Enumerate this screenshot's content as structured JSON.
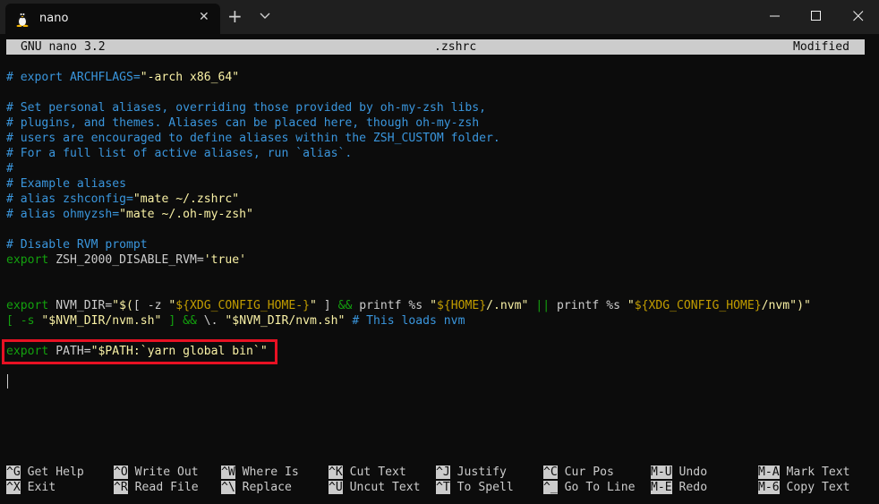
{
  "tab": {
    "title": "nano",
    "close_glyph": "✕",
    "icon": "tux-icon"
  },
  "titlebar": {
    "new_tab_glyph": "+"
  },
  "header": {
    "left": "GNU nano 3.2",
    "center": ".zshrc",
    "right": "Modified"
  },
  "lines": [
    [
      {
        "t": "# export ARCHFLAGS=",
        "c": "comment"
      },
      {
        "t": "\"-arch x86_64\"",
        "c": "str"
      }
    ],
    [],
    [
      {
        "t": "# Set personal aliases, overriding those provided by oh-my-zsh libs,",
        "c": "comment"
      }
    ],
    [
      {
        "t": "# plugins, and themes. Aliases can be placed here, though oh-my-zsh",
        "c": "comment"
      }
    ],
    [
      {
        "t": "# users are encouraged to define aliases within the ZSH_CUSTOM folder.",
        "c": "comment"
      }
    ],
    [
      {
        "t": "# For a full list of active aliases, run `alias`.",
        "c": "comment"
      }
    ],
    [
      {
        "t": "#",
        "c": "comment"
      }
    ],
    [
      {
        "t": "# Example aliases",
        "c": "comment"
      }
    ],
    [
      {
        "t": "# alias zshconfig=",
        "c": "comment"
      },
      {
        "t": "\"mate ~/.zshrc\"",
        "c": "str"
      }
    ],
    [
      {
        "t": "# alias ohmyzsh=",
        "c": "comment"
      },
      {
        "t": "\"mate ~/.oh-my-zsh\"",
        "c": "str"
      }
    ],
    [],
    [
      {
        "t": "# Disable RVM prompt",
        "c": "comment"
      }
    ],
    [
      {
        "t": "export",
        "c": "kw"
      },
      {
        "t": " ZSH_2000_DISABLE_RVM=",
        "c": "plain"
      },
      {
        "t": "'true'",
        "c": "str"
      }
    ],
    [],
    [],
    [
      {
        "t": "export",
        "c": "kw"
      },
      {
        "t": " NVM_DIR=",
        "c": "plain"
      },
      {
        "t": "\"$(",
        "c": "str"
      },
      {
        "t": "[ -z ",
        "c": "plain"
      },
      {
        "t": "\"",
        "c": "str"
      },
      {
        "t": "${XDG_CONFIG_HOME-}",
        "c": "var"
      },
      {
        "t": "\"",
        "c": "str"
      },
      {
        "t": " ] ",
        "c": "plain"
      },
      {
        "t": "&&",
        "c": "kw"
      },
      {
        "t": " printf %s ",
        "c": "plain"
      },
      {
        "t": "\"",
        "c": "str"
      },
      {
        "t": "${HOME}",
        "c": "var"
      },
      {
        "t": "/.nvm\"",
        "c": "str"
      },
      {
        "t": " ",
        "c": "plain"
      },
      {
        "t": "||",
        "c": "kw"
      },
      {
        "t": " printf %s ",
        "c": "plain"
      },
      {
        "t": "\"",
        "c": "str"
      },
      {
        "t": "${XDG_CONFIG_HOME}",
        "c": "var"
      },
      {
        "t": "/nvm\"",
        "c": "str"
      },
      {
        "t": ")\"",
        "c": "str"
      }
    ],
    [
      {
        "t": "[ -s ",
        "c": "kw"
      },
      {
        "t": "\"$NVM_DIR/nvm.sh\"",
        "c": "str"
      },
      {
        "t": " ] ",
        "c": "kw"
      },
      {
        "t": "&&",
        "c": "kw"
      },
      {
        "t": " \\. ",
        "c": "plain"
      },
      {
        "t": "\"$NVM_DIR/nvm.sh\"",
        "c": "str"
      },
      {
        "t": " # This loads nvm",
        "c": "comment"
      }
    ],
    [],
    [
      {
        "t": "export",
        "c": "kw"
      },
      {
        "t": " PATH=",
        "c": "plain"
      },
      {
        "t": "\"$PATH:`yarn global bin`\"",
        "c": "str"
      }
    ]
  ],
  "shortcuts_row1": [
    {
      "key": "^G",
      "label": "Get Help"
    },
    {
      "key": "^O",
      "label": "Write Out"
    },
    {
      "key": "^W",
      "label": "Where Is"
    },
    {
      "key": "^K",
      "label": "Cut Text"
    },
    {
      "key": "^J",
      "label": "Justify"
    },
    {
      "key": "^C",
      "label": "Cur Pos"
    },
    {
      "key": "M-U",
      "label": "Undo"
    },
    {
      "key": "M-A",
      "label": "Mark Text"
    }
  ],
  "shortcuts_row2": [
    {
      "key": "^X",
      "label": "Exit"
    },
    {
      "key": "^R",
      "label": "Read File"
    },
    {
      "key": "^\\",
      "label": "Replace"
    },
    {
      "key": "^U",
      "label": "Uncut Text"
    },
    {
      "key": "^T",
      "label": "To Spell"
    },
    {
      "key": "^_",
      "label": "Go To Line"
    },
    {
      "key": "M-E",
      "label": "Redo"
    },
    {
      "key": "M-6",
      "label": "Copy Text"
    }
  ],
  "colors": {
    "comment": "#3a96dd",
    "string": "#f9f1a5",
    "keyword": "#13a10e",
    "variable": "#c19c00",
    "highlight_box": "#e81123"
  }
}
